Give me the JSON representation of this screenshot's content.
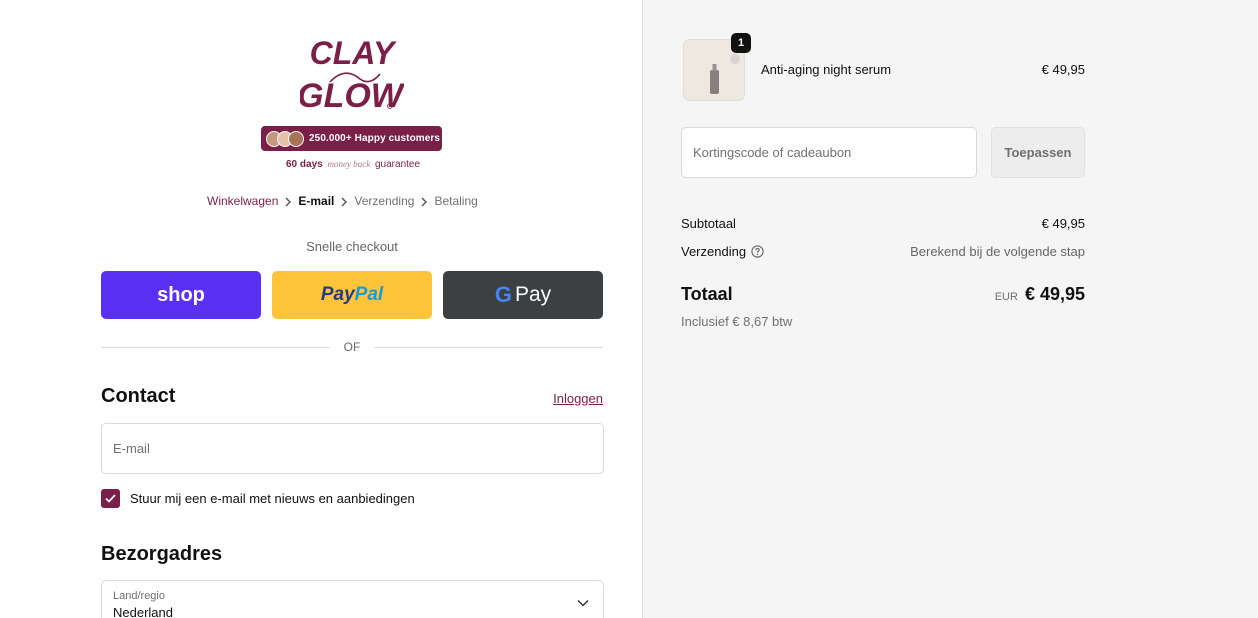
{
  "brand": {
    "logo_line1": "CLAY",
    "logo_line2": "GLOW",
    "badge_text": "250.000+ Happy customers",
    "guarantee_days": "60 days",
    "guarantee_middle": "money back",
    "guarantee_end": "guarantee",
    "accent_color": "#7a1f47"
  },
  "breadcrumb": {
    "items": [
      "Winkelwagen",
      "E-mail",
      "Verzending",
      "Betaling"
    ]
  },
  "express": {
    "title": "Snelle checkout",
    "shop_label": "shop",
    "paypal_part1": "Pay",
    "paypal_part2": "Pal",
    "gpay_g": "G",
    "gpay_label": "Pay",
    "or_text": "OF"
  },
  "contact": {
    "heading": "Contact",
    "login_link": "Inloggen",
    "email_placeholder": "E-mail",
    "newsletter_label": "Stuur mij een e-mail met nieuws en aanbiedingen",
    "newsletter_checked": true
  },
  "address": {
    "heading": "Bezorgadres",
    "country_label": "Land/regio",
    "country_value": "Nederland"
  },
  "order": {
    "quantity": "1",
    "product_name": "Anti-aging night serum",
    "product_price": "€ 49,95",
    "discount_placeholder": "Kortingscode of cadeaubon",
    "apply_label": "Toepassen",
    "subtotal_label": "Subtotaal",
    "subtotal_value": "€ 49,95",
    "shipping_label": "Verzending",
    "shipping_value": "Berekend bij de volgende stap",
    "total_label": "Totaal",
    "currency": "EUR",
    "total_value": "€ 49,95",
    "vat_note": "Inclusief € 8,67 btw"
  }
}
